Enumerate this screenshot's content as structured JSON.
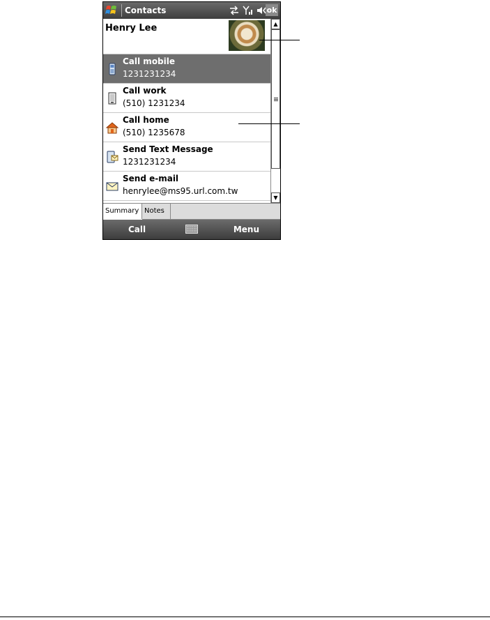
{
  "app": {
    "title": "Contacts",
    "ok_label": "ok"
  },
  "contact": {
    "name": "Henry Lee"
  },
  "actions": [
    {
      "title": "Call mobile",
      "detail": "1231231234",
      "icon": "mobile-phone-icon",
      "selected": true
    },
    {
      "title": "Call work",
      "detail": "(510) 1231234",
      "icon": "work-phone-icon",
      "selected": false
    },
    {
      "title": "Call home",
      "detail": "(510) 1235678",
      "icon": "home-icon",
      "selected": false
    },
    {
      "title": "Send Text Message",
      "detail": "1231231234",
      "icon": "text-message-icon",
      "selected": false
    },
    {
      "title": "Send e-mail",
      "detail": "henrylee@ms95.url.com.tw",
      "icon": "email-icon",
      "selected": false
    }
  ],
  "tabs": [
    {
      "label": "Summary",
      "active": true
    },
    {
      "label": "Notes",
      "active": false
    }
  ],
  "softkeys": {
    "left": "Call",
    "right": "Menu"
  },
  "colors": {
    "titlebar": "#4a4a4a",
    "selection": "#6e6e6e",
    "home_icon": "#e0641a"
  }
}
